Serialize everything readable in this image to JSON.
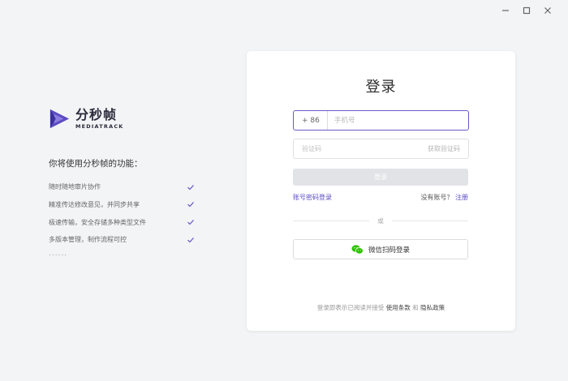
{
  "window": {
    "minimize_icon": "minimize-icon",
    "maximize_icon": "maximize-icon",
    "close_icon": "close-icon"
  },
  "brand": {
    "name_cn": "分秒帧",
    "name_en": "MEDIATRACK",
    "logo_icon": "mediatrack-logo-icon",
    "logo_color": "#5b4bc4"
  },
  "features": {
    "title": "你将使用分秒帧的功能：",
    "items": [
      {
        "label": "随时随地审片协作"
      },
      {
        "label": "精准传达修改意见，并同步共享"
      },
      {
        "label": "极速传输，安全存储多种类型文件"
      },
      {
        "label": "多版本管理，制作流程可控"
      }
    ],
    "more": "......",
    "check_icon": "check-icon",
    "check_color": "#6a5ac8"
  },
  "login": {
    "title": "登录",
    "country_code": "+ 86",
    "phone_placeholder": "手机号",
    "code_placeholder": "验证码",
    "get_code": "获取验证码",
    "submit": "登录",
    "password_login": "账号密码登录",
    "no_account": "没有账号？",
    "register": "注册",
    "or": "或",
    "wechat_login": "微信扫码登录",
    "wechat_icon": "wechat-icon",
    "agreement_prefix": "登录即表示已阅读并接受",
    "terms": "使用条款",
    "and": "和",
    "privacy": "隐私政策",
    "accent_color": "#5b4bc4"
  }
}
